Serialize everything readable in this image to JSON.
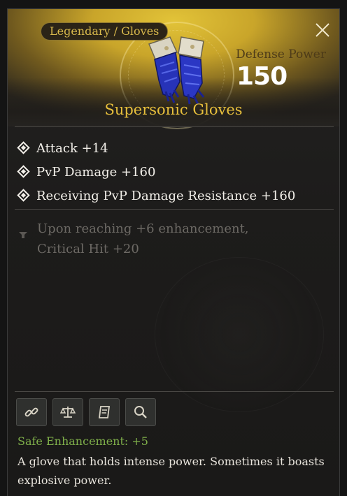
{
  "item": {
    "rarity_type": "Legendary / Gloves",
    "name": "Supersonic Gloves",
    "defense_label": "Defense Power",
    "defense_value": "150"
  },
  "stats": [
    {
      "label": "Attack +14"
    },
    {
      "label": "PvP Damage +160"
    },
    {
      "label": "Receiving PvP Damage Resistance +160"
    }
  ],
  "enhancement_effect": {
    "line1": "Upon reaching +6 enhancement,",
    "line2": "Critical Hit +20"
  },
  "actions": [
    {
      "icon": "link-icon"
    },
    {
      "icon": "scale-icon"
    },
    {
      "icon": "scroll-icon"
    },
    {
      "icon": "search-icon"
    }
  ],
  "safe_enhancement": "Safe Enhancement: +5",
  "description": "A glove that holds intense power. Sometimes it boasts explosive power.",
  "colors": {
    "rarity_gold": "#e7bf3c",
    "safe_green": "#7fb04a"
  }
}
